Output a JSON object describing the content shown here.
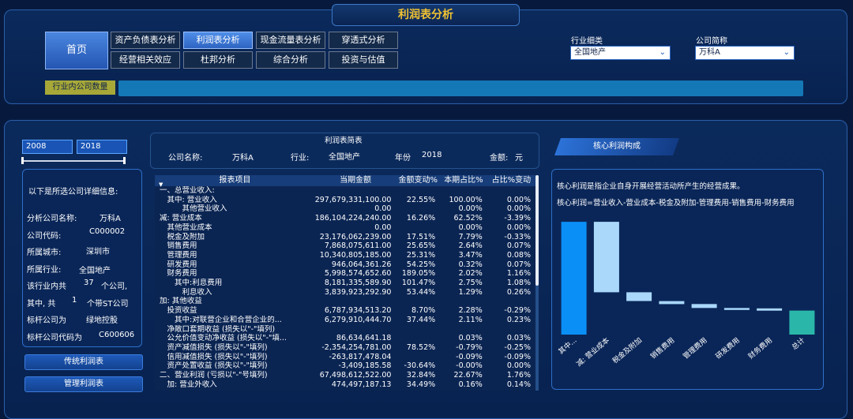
{
  "header": {
    "title": "利润表分析"
  },
  "nav": {
    "home": "首页",
    "row1": [
      "资产负债表分析",
      "利润表分析",
      "现金流量表分析",
      "穿透式分析"
    ],
    "row2": [
      "经营相关效应",
      "杜邦分析",
      "综合分析",
      "投资与估值"
    ],
    "active": "利润表分析"
  },
  "filters": {
    "industry_label": "行业细类",
    "industry_value": "全国地产",
    "company_label": "公司简称",
    "company_value": "万科A"
  },
  "count_label": "行业内公司数量",
  "years": {
    "start": "2008",
    "end": "2018"
  },
  "info": {
    "title": "以下是所选公司详细信息:",
    "company_label": "分析公司名称:",
    "company_value": "万科A",
    "code_label": "公司代码:",
    "code_value": "C000002",
    "city_label": "所属城市:",
    "city_value": "深圳市",
    "industry_label": "所属行业:",
    "industry_value": "全国地产",
    "count_pre": "该行业内共",
    "count_value": "37",
    "count_post": "个公司,",
    "st_pre": "其中, 共",
    "st_value": "1",
    "st_post": "个带ST公司",
    "bench_label": "标杆公司为",
    "bench_value": "绿地控股",
    "bench_code_label": "标杆公司代码为",
    "bench_code_value": "C600606"
  },
  "side_buttons": [
    "传统利润表",
    "管理利润表"
  ],
  "report": {
    "title": "利润表简表",
    "company_label": "公司名称:",
    "company_value": "万科A",
    "industry_label": "行业:",
    "industry_value": "全国地产",
    "year_label": "年份",
    "year_value": "2018",
    "unit_label": "金额:",
    "unit_value": "元"
  },
  "table": {
    "headers": [
      "报表项目",
      "当期金额",
      "金额变动%",
      "本期占比%",
      "占比%变动"
    ],
    "rows": [
      [
        "一、总营业收入:",
        "",
        "",
        "",
        ""
      ],
      [
        "　其中: 营业收入",
        "297,679,331,100.00",
        "22.55%",
        "100.00%",
        "0.00%"
      ],
      [
        "　　　其他营业收入",
        "0.00",
        "",
        "0.00%",
        "0.00%"
      ],
      [
        "减: 营业成本",
        "186,104,224,240.00",
        "16.26%",
        "62.52%",
        "-3.39%"
      ],
      [
        "　其他营业成本",
        "0.00",
        "",
        "0.00%",
        "0.00%"
      ],
      [
        "　税金及附加",
        "23,176,062,239.00",
        "17.51%",
        "7.79%",
        "-0.33%"
      ],
      [
        "　销售费用",
        "7,868,075,611.00",
        "25.65%",
        "2.64%",
        "0.07%"
      ],
      [
        "　管理费用",
        "10,340,805,185.00",
        "25.31%",
        "3.47%",
        "0.08%"
      ],
      [
        "　研发费用",
        "946,064,361.26",
        "54.25%",
        "0.32%",
        "0.07%"
      ],
      [
        "　财务费用",
        "5,998,574,652.60",
        "189.05%",
        "2.02%",
        "1.16%"
      ],
      [
        "　　其中:利息费用",
        "8,181,335,589.90",
        "101.47%",
        "2.75%",
        "1.08%"
      ],
      [
        "　　　利息收入",
        "3,839,923,292.90",
        "53.44%",
        "1.29%",
        "0.26%"
      ],
      [
        "加: 其他收益",
        "",
        "",
        "",
        ""
      ],
      [
        "　投资收益",
        "6,787,934,513.20",
        "8.70%",
        "2.28%",
        "-0.29%"
      ],
      [
        "　　其中:对联营企业和合营企业的...",
        "6,279,910,444.70",
        "37.44%",
        "2.11%",
        "0.23%"
      ],
      [
        "　净敞口套期收益 (损失以\"-\"填列)",
        "",
        "",
        "",
        ""
      ],
      [
        "　公允价值变动净收益 (损失以\"-\"填...",
        "86,634,641.18",
        "",
        "0.03%",
        "0.03%"
      ],
      [
        "　资产减值损失 (损失以\"-\"填列)",
        "-2,354,254,781.00",
        "78.52%",
        "-0.79%",
        "-0.25%"
      ],
      [
        "　信用减值损失 (损失以\"-\"填列)",
        "-263,817,478.04",
        "",
        "-0.09%",
        "-0.09%"
      ],
      [
        "　资产处置收益 (损失以\"-\"填列)",
        "-3,409,185.58",
        "-30.64%",
        "-0.00%",
        "0.00%"
      ],
      [
        "二、营业利润 (亏损以\"-\"号填列)",
        "67,498,612,522.00",
        "32.84%",
        "22.67%",
        "1.76%"
      ],
      [
        "　加: 营业外收入",
        "474,497,187.13",
        "34.49%",
        "0.16%",
        "0.14%"
      ]
    ]
  },
  "core": {
    "tab": "核心利润构成",
    "desc": "核心利润是指企业自身开展经营活动所产生的经营成果。",
    "formula": "核心利润=营业收入-营业成本-税金及附加-管理费用-销售费用-财务费用"
  },
  "chart_data": {
    "type": "bar",
    "subtype": "waterfall",
    "categories": [
      "其中...",
      "减: 营业成本",
      "税金及附加",
      "销售费用",
      "管理费用",
      "研发费用",
      "财务费用",
      "总计"
    ],
    "values": [
      297.68,
      -186.1,
      -23.18,
      -7.87,
      -10.34,
      -0.95,
      -6.0,
      63.24
    ],
    "colors": {
      "start": "#0a8ff7",
      "decrease": "#a9d8fb",
      "total": "#2ab7aa"
    }
  }
}
